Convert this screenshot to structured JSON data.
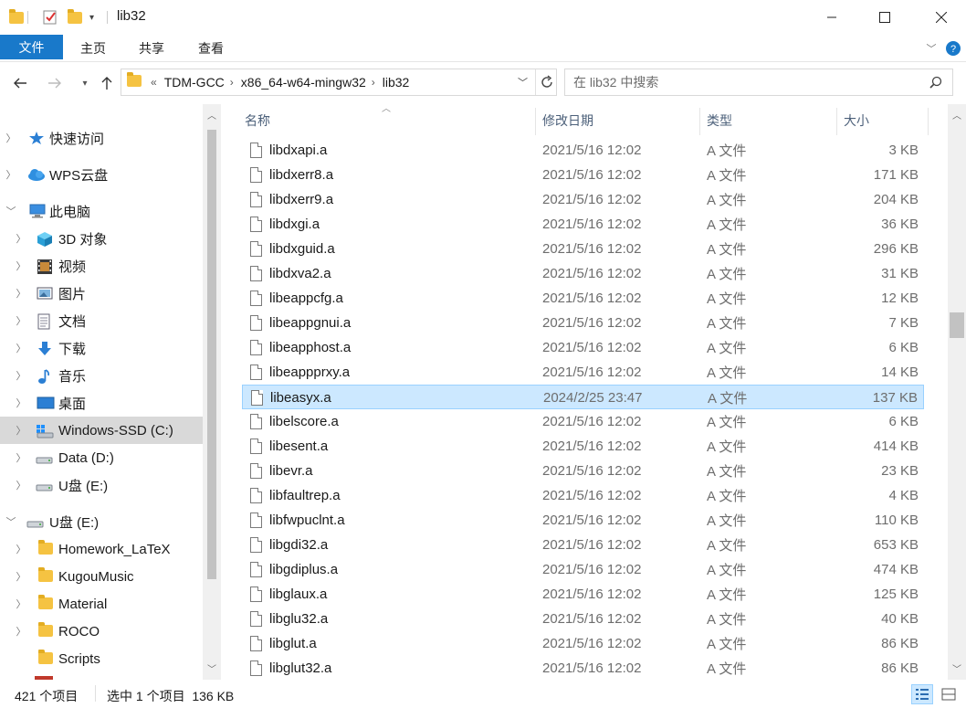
{
  "titlebar": {
    "title": "lib32",
    "minimize_icon": "minimize-icon",
    "maximize_icon": "maximize-icon",
    "close_icon": "close-icon"
  },
  "ribbon": {
    "tabs": [
      {
        "label": "文件"
      },
      {
        "label": "主页"
      },
      {
        "label": "共享"
      },
      {
        "label": "查看"
      }
    ]
  },
  "address": {
    "overflow": "«",
    "crumbs": [
      "TDM-GCC",
      "x86_64-w64-mingw32",
      "lib32"
    ]
  },
  "search": {
    "placeholder": "在 lib32 中搜索"
  },
  "nav": {
    "items": [
      {
        "label": "快速访问"
      },
      {
        "label": "WPS云盘"
      },
      {
        "label": "此电脑"
      },
      {
        "label": "3D 对象"
      },
      {
        "label": "视频"
      },
      {
        "label": "图片"
      },
      {
        "label": "文档"
      },
      {
        "label": "下载"
      },
      {
        "label": "音乐"
      },
      {
        "label": "桌面"
      },
      {
        "label": "Windows-SSD (C:)"
      },
      {
        "label": "Data (D:)"
      },
      {
        "label": "U盘 (E:)"
      },
      {
        "label": "U盘 (E:)"
      },
      {
        "label": "Homework_LaTeX"
      },
      {
        "label": "KugouMusic"
      },
      {
        "label": "Material"
      },
      {
        "label": "ROCO"
      },
      {
        "label": "Scripts"
      }
    ]
  },
  "columns": {
    "name": "名称",
    "date": "修改日期",
    "type": "类型",
    "size": "大小"
  },
  "files": [
    {
      "name": "libdxapi.a",
      "date": "2021/5/16 12:02",
      "type": "A 文件",
      "size": "3 KB"
    },
    {
      "name": "libdxerr8.a",
      "date": "2021/5/16 12:02",
      "type": "A 文件",
      "size": "171 KB"
    },
    {
      "name": "libdxerr9.a",
      "date": "2021/5/16 12:02",
      "type": "A 文件",
      "size": "204 KB"
    },
    {
      "name": "libdxgi.a",
      "date": "2021/5/16 12:02",
      "type": "A 文件",
      "size": "36 KB"
    },
    {
      "name": "libdxguid.a",
      "date": "2021/5/16 12:02",
      "type": "A 文件",
      "size": "296 KB"
    },
    {
      "name": "libdxva2.a",
      "date": "2021/5/16 12:02",
      "type": "A 文件",
      "size": "31 KB"
    },
    {
      "name": "libeappcfg.a",
      "date": "2021/5/16 12:02",
      "type": "A 文件",
      "size": "12 KB"
    },
    {
      "name": "libeappgnui.a",
      "date": "2021/5/16 12:02",
      "type": "A 文件",
      "size": "7 KB"
    },
    {
      "name": "libeapphost.a",
      "date": "2021/5/16 12:02",
      "type": "A 文件",
      "size": "6 KB"
    },
    {
      "name": "libeappprxy.a",
      "date": "2021/5/16 12:02",
      "type": "A 文件",
      "size": "14 KB"
    },
    {
      "name": "libeasyx.a",
      "date": "2024/2/25 23:47",
      "type": "A 文件",
      "size": "137 KB"
    },
    {
      "name": "libelscore.a",
      "date": "2021/5/16 12:02",
      "type": "A 文件",
      "size": "6 KB"
    },
    {
      "name": "libesent.a",
      "date": "2021/5/16 12:02",
      "type": "A 文件",
      "size": "414 KB"
    },
    {
      "name": "libevr.a",
      "date": "2021/5/16 12:02",
      "type": "A 文件",
      "size": "23 KB"
    },
    {
      "name": "libfaultrep.a",
      "date": "2021/5/16 12:02",
      "type": "A 文件",
      "size": "4 KB"
    },
    {
      "name": "libfwpuclnt.a",
      "date": "2021/5/16 12:02",
      "type": "A 文件",
      "size": "110 KB"
    },
    {
      "name": "libgdi32.a",
      "date": "2021/5/16 12:02",
      "type": "A 文件",
      "size": "653 KB"
    },
    {
      "name": "libgdiplus.a",
      "date": "2021/5/16 12:02",
      "type": "A 文件",
      "size": "474 KB"
    },
    {
      "name": "libglaux.a",
      "date": "2021/5/16 12:02",
      "type": "A 文件",
      "size": "125 KB"
    },
    {
      "name": "libglu32.a",
      "date": "2021/5/16 12:02",
      "type": "A 文件",
      "size": "40 KB"
    },
    {
      "name": "libglut.a",
      "date": "2021/5/16 12:02",
      "type": "A 文件",
      "size": "86 KB"
    },
    {
      "name": "libglut32.a",
      "date": "2021/5/16 12:02",
      "type": "A 文件",
      "size": "86 KB"
    }
  ],
  "status": {
    "count": "421 个项目",
    "selection": "选中 1 个项目  136 KB"
  },
  "colors": {
    "file_tab": "#1979ca",
    "selection_bg": "#cce8ff",
    "selection_border": "#99d1ff",
    "header_text": "#4c607a",
    "nav_selected": "#d9d9d9"
  }
}
